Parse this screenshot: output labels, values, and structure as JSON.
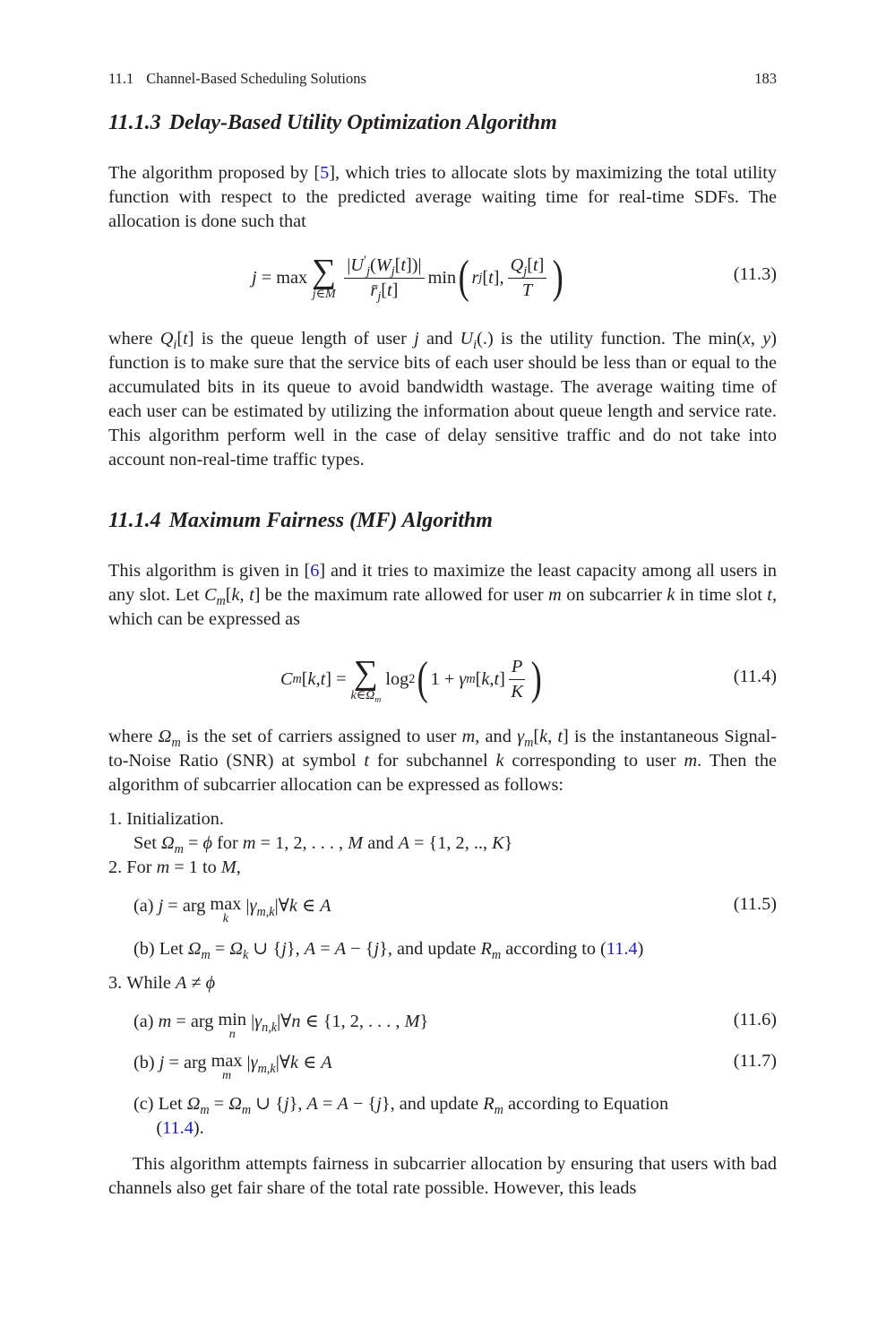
{
  "running_head": {
    "section_number": "11.1",
    "section_title": "Channel-Based Scheduling Solutions",
    "page_number": "183"
  },
  "section_1113": {
    "number": "11.1.3",
    "title": "Delay-Based Utility Optimization Algorithm",
    "para1_a": "The algorithm proposed by [",
    "para1_ref": "5",
    "para1_b": "], which tries to allocate slots by maximizing the total utility function with respect to the predicted average waiting time for real-time SDFs. The allocation is done such that",
    "eq_number": "(11.3)",
    "para2_a": "where ",
    "para2_b": " is the queue length of user ",
    "para2_c": " and ",
    "para2_d": " is the utility function. The ",
    "para2_e": " function is to make sure that the service bits of each user should be less than or equal to the accumulated bits in its queue to avoid bandwidth wastage. The average waiting time of each user can be estimated by utilizing the information about queue length and service rate. This algorithm perform well in the case of delay sensitive traffic and do not take into account non-real-time traffic types."
  },
  "section_1114": {
    "number": "11.1.4",
    "title": "Maximum Fairness (MF) Algorithm",
    "para1_a": "This algorithm is given in [",
    "para1_ref": "6",
    "para1_b": "] and it tries to maximize the least capacity among all users in any slot. Let ",
    "para1_c": " be the maximum rate allowed for user ",
    "para1_d": " on subcarrier ",
    "para1_e": " in time slot ",
    "para1_f": ", which can be expressed as",
    "eq_number": "(11.4)",
    "para2_a": "where ",
    "para2_b": " is the set of carriers assigned to user ",
    "para2_c": ", and ",
    "para2_d": " is the instantaneous Signal-to-Noise Ratio (SNR) at symbol ",
    "para2_e": " for subchannel ",
    "para2_f": " corresponding to user ",
    "para2_g": ". Then the algorithm of subcarrier allocation can be expressed as follows:",
    "steps": {
      "s1_label": "1.",
      "s1_text": "Initialization.",
      "s1_set": "Set",
      "s1_for": "for",
      "s1_and": "and",
      "s2_label": "2.",
      "s2_text": "For",
      "s2_to": "to",
      "s2a_label": "(a)",
      "s2a_eqno": "(11.5)",
      "s2b_label": "(b) Let",
      "s2b_text": ", and update",
      "s2b_acc": "according to (",
      "s2b_ref": "11.4",
      "s2b_close": ")",
      "s3_label": "3.",
      "s3_text": "While",
      "s3a_label": "(a)",
      "s3a_eqno": "(11.6)",
      "s3b_label": "(b)",
      "s3b_eqno": "(11.7)",
      "s3c_label": "(c) Let",
      "s3c_text": ", and update",
      "s3c_acc": "according to Equation",
      "s3c_open": "(",
      "s3c_ref": "11.4",
      "s3c_close": ")."
    },
    "closing_para": "This algorithm attempts fairness in subcarrier allocation by ensuring that users with bad channels also get fair share of the total rate possible. However, this leads"
  },
  "colors": {
    "text": "#231f20",
    "link": "#1a1ad6"
  }
}
